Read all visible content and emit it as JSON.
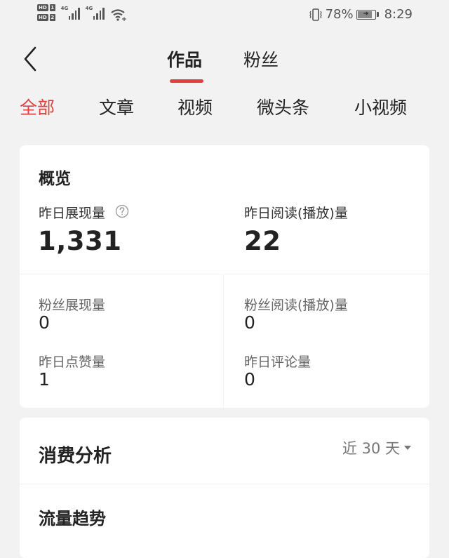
{
  "status_bar": {
    "sim1_badge": "HD",
    "sim1_num": "1",
    "sim2_badge": "HD",
    "sim2_num": "2",
    "net1": "4G",
    "net2": "4G",
    "battery_percent": "78%",
    "time": "8:29",
    "icons": [
      "signal-icon",
      "wifi-icon",
      "vibrate-icon",
      "battery-charging-icon"
    ]
  },
  "header": {
    "back_icon": "chevron-left-icon",
    "tabs": [
      {
        "label": "作品",
        "active": true
      },
      {
        "label": "粉丝",
        "active": false
      }
    ],
    "accent_color": "#e0403f"
  },
  "categories": [
    {
      "label": "全部",
      "active": true
    },
    {
      "label": "文章",
      "active": false
    },
    {
      "label": "视频",
      "active": false
    },
    {
      "label": "微头条",
      "active": false
    },
    {
      "label": "小视频",
      "active": false
    }
  ],
  "overview": {
    "title": "概览",
    "primary": [
      {
        "label": "昨日展现量",
        "value": "1,331",
        "help_icon": "question-circle-icon"
      },
      {
        "label": "昨日阅读(播放)量",
        "value": "22"
      }
    ],
    "secondary": [
      {
        "label": "粉丝展现量",
        "value": "0"
      },
      {
        "label": "粉丝阅读(播放)量",
        "value": "0"
      },
      {
        "label": "昨日点赞量",
        "value": "1"
      },
      {
        "label": "昨日评论量",
        "value": "0"
      }
    ]
  },
  "consumption": {
    "title": "消费分析",
    "range_label": "近 30 天",
    "trend_title": "流量趋势"
  }
}
